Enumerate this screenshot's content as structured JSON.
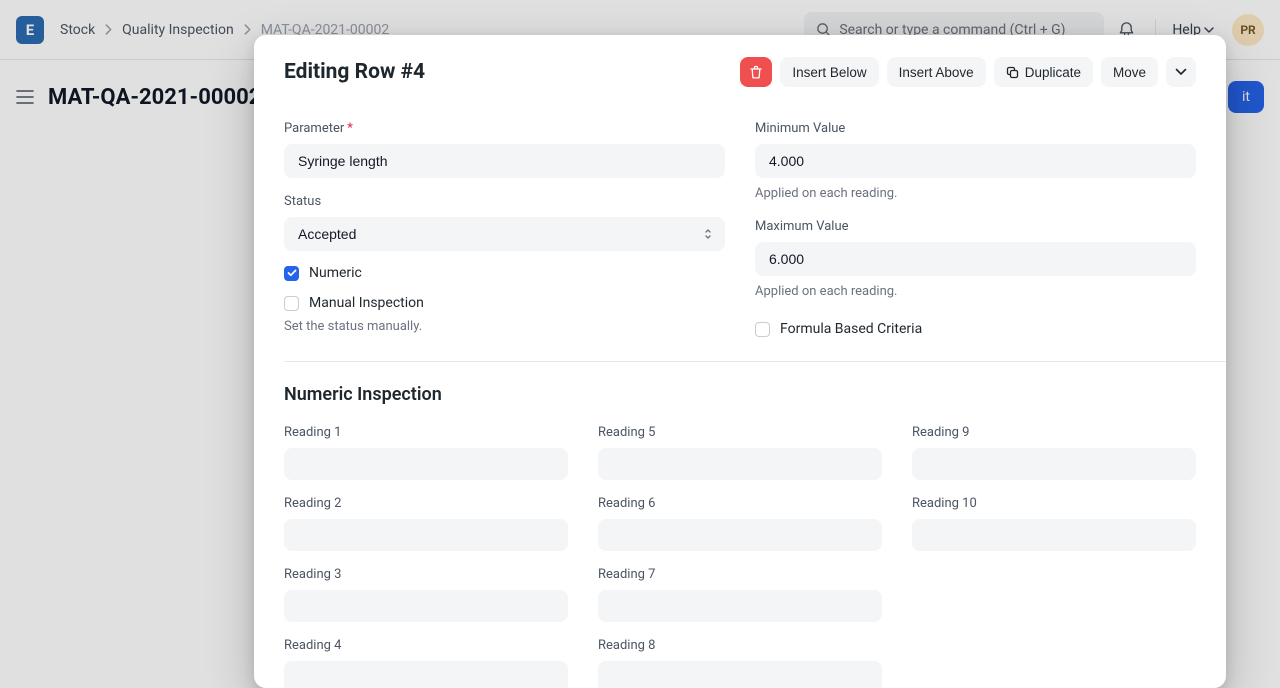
{
  "nav": {
    "logo_letter": "E",
    "breadcrumb1": "Stock",
    "breadcrumb2": "Quality Inspection",
    "breadcrumb3": "MAT-QA-2021-00002",
    "search_placeholder": "Search or type a command (Ctrl + G)",
    "help_label": "Help",
    "avatar_initials": "PR"
  },
  "page": {
    "title": "MAT-QA-2021-00002",
    "submit_partial": "it"
  },
  "modal": {
    "title": "Editing Row #4",
    "btn_insert_below": "Insert Below",
    "btn_insert_above": "Insert Above",
    "btn_duplicate": "Duplicate",
    "btn_move": "Move"
  },
  "form": {
    "parameter_label": "Parameter",
    "parameter_value": "Syringe length",
    "status_label": "Status",
    "status_value": "Accepted",
    "numeric_label": "Numeric",
    "manual_label": "Manual Inspection",
    "manual_help": "Set the status manually.",
    "min_label": "Minimum Value",
    "min_value": "4.000",
    "min_help": "Applied on each reading.",
    "max_label": "Maximum Value",
    "max_value": "6.000",
    "max_help": "Applied on each reading.",
    "formula_label": "Formula Based Criteria"
  },
  "readings": {
    "section_title": "Numeric Inspection",
    "col1": [
      "Reading 1",
      "Reading 2",
      "Reading 3",
      "Reading 4"
    ],
    "col2": [
      "Reading 5",
      "Reading 6",
      "Reading 7",
      "Reading 8"
    ],
    "col3": [
      "Reading 9",
      "Reading 10"
    ]
  }
}
